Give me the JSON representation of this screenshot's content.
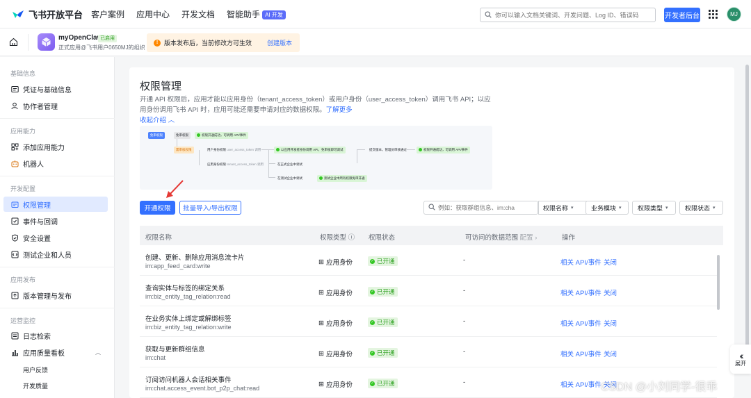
{
  "topnav": {
    "brand": "飞书开放平台",
    "links": [
      "客户案例",
      "应用中心",
      "开发文档",
      "智能助手"
    ],
    "ai_badge": "AI 开发",
    "search_placeholder": "你可以输入文档关键词、开发问题、Log ID、错误码",
    "dev_console": "开发者后台",
    "avatar_initials": "MJ"
  },
  "appbar": {
    "app_name": "myOpenClaw",
    "app_status": "已启用",
    "app_org": "正式应用@飞书用户0650MJ的组织",
    "notice_text": "版本发布后，当前修改方可生效",
    "notice_link": "创建版本"
  },
  "sidebar": {
    "groups": [
      "基础信息",
      "应用能力",
      "开发配置",
      "应用发布",
      "运营监控"
    ],
    "items": [
      "凭证与基础信息",
      "协作者管理",
      "添加应用能力",
      "机器人",
      "权限管理",
      "事件与回调",
      "安全设置",
      "测试企业和人员",
      "版本管理与发布",
      "日志检索",
      "应用质量看板"
    ],
    "subitems": [
      "用户反馈",
      "开发质量"
    ]
  },
  "main": {
    "title": "权限管理",
    "desc": "开通 API 权限后，应用才能以应用身份（tenant_access_token）或用户身份（user_access_token）调用飞书 API；以应用身份调用飞书 API 时，应用可能还需要申请对应的数据权限。",
    "learn_more": "了解更多",
    "collapse": "收起介绍",
    "flow": {
      "free": "免审权限",
      "need_review": "需审核权限",
      "free_result": "权限开通成功，可调用 API/事件",
      "user_identity": "用户身份权限",
      "user_token": "user_access_token 调用",
      "app_identity": "应用身份权限",
      "tenant_token": "tenant_access_token 调用",
      "admin_enabled": "以应用开发者身份调用 API，免审核即可调试",
      "submit": "提交版本，管理员审核通过",
      "done": "权限开通成功，可调用 API/事件",
      "prod_test": "在正式企业中调试",
      "test_test": "在测试企业中调试",
      "test_all": "测试企业中所有权限免审开通"
    },
    "btn_enable": "开通权限",
    "btn_batch": "批量导入/导出权限",
    "filter_placeholder": "例如：获取群组信息、im:cha...",
    "filter_field": "权限名称",
    "filters": [
      "业务模块",
      "权限类型",
      "权限状态"
    ],
    "columns": [
      "权限名称",
      "权限类型",
      "权限状态",
      "可访问的数据范围",
      "配置",
      "操作"
    ],
    "rows": [
      {
        "name": "创建、更新、删除应用消息流卡片",
        "scope": "im:app_feed_card:write",
        "type": "应用身份",
        "status": "已开通",
        "range": "-",
        "api": "相关 API/事件",
        "close": "关闭"
      },
      {
        "name": "查询实体与标签的绑定关系",
        "scope": "im:biz_entity_tag_relation:read",
        "type": "应用身份",
        "status": "已开通",
        "range": "-",
        "api": "相关 API/事件",
        "close": "关闭"
      },
      {
        "name": "在业务实体上绑定或解绑标签",
        "scope": "im:biz_entity_tag_relation:write",
        "type": "应用身份",
        "status": "已开通",
        "range": "-",
        "api": "相关 API/事件",
        "close": "关闭"
      },
      {
        "name": "获取与更新群组信息",
        "scope": "im:chat",
        "type": "应用身份",
        "status": "已开通",
        "range": "-",
        "api": "相关 API/事件",
        "close": "关闭"
      },
      {
        "name": "订阅访问机器人会话相关事件",
        "scope": "im:chat.access_event.bot_p2p_chat:read",
        "type": "应用身份",
        "status": "已开通",
        "range": "-",
        "api": "相关 API/事件",
        "close": "关闭"
      }
    ]
  },
  "expand": "展开",
  "watermark": "CSDN @小刘同学-很乖",
  "colors": {
    "accent": "#3370ff",
    "success": "#2ea121",
    "notice_bg": "#fff3e3"
  }
}
